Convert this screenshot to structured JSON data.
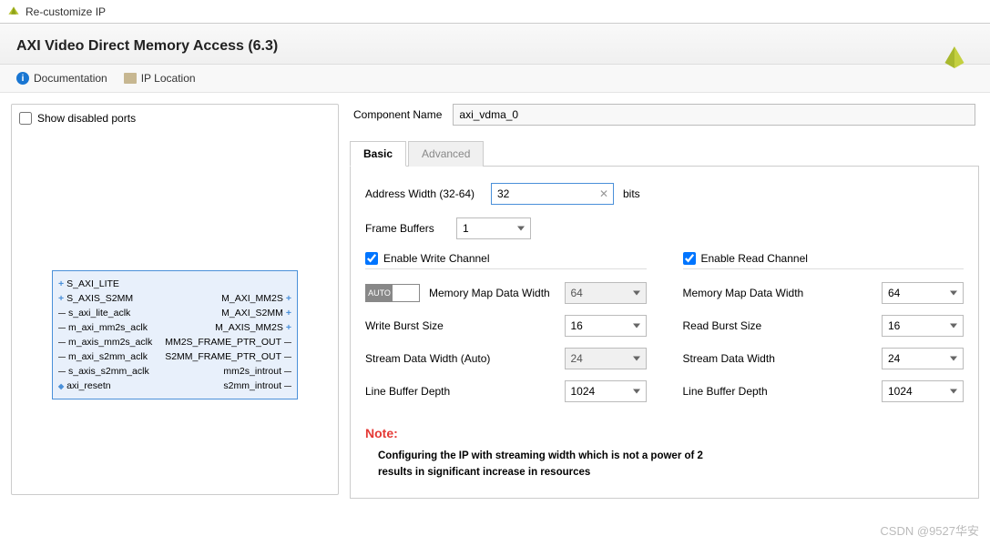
{
  "window": {
    "title": "Re-customize IP"
  },
  "header": {
    "ip_title": "AXI Video Direct Memory Access (6.3)"
  },
  "toolbar": {
    "documentation": "Documentation",
    "ip_location": "IP Location"
  },
  "left": {
    "show_disabled_ports": "Show disabled ports",
    "ports": {
      "left": [
        "S_AXI_LITE",
        "S_AXIS_S2MM",
        "s_axi_lite_aclk",
        "m_axi_mm2s_aclk",
        "m_axis_mm2s_aclk",
        "m_axi_s2mm_aclk",
        "s_axis_s2mm_aclk",
        "axi_resetn"
      ],
      "right": [
        "M_AXI_MM2S",
        "M_AXI_S2MM",
        "M_AXIS_MM2S",
        "MM2S_FRAME_PTR_OUT",
        "S2MM_FRAME_PTR_OUT",
        "mm2s_introut",
        "s2mm_introut"
      ]
    }
  },
  "right": {
    "component_name_label": "Component Name",
    "component_name": "axi_vdma_0",
    "tabs": {
      "basic": "Basic",
      "advanced": "Advanced"
    },
    "basic": {
      "address_width_label": "Address Width (32-64)",
      "address_width_value": "32",
      "address_width_suffix": "bits",
      "frame_buffers_label": "Frame Buffers",
      "frame_buffers_value": "1",
      "write_channel": {
        "enable_label": "Enable Write Channel",
        "auto_label": "AUTO",
        "mem_map_label": "Memory Map Data Width",
        "mem_map_value": "64",
        "burst_label": "Write Burst Size",
        "burst_value": "16",
        "stream_label": "Stream Data Width (Auto)",
        "stream_value": "24",
        "line_buf_label": "Line Buffer Depth",
        "line_buf_value": "1024"
      },
      "read_channel": {
        "enable_label": "Enable Read Channel",
        "mem_map_label": "Memory Map Data Width",
        "mem_map_value": "64",
        "burst_label": "Read Burst Size",
        "burst_value": "16",
        "stream_label": "Stream Data Width",
        "stream_value": "24",
        "line_buf_label": "Line Buffer Depth",
        "line_buf_value": "1024"
      },
      "note_title": "Note:",
      "note_text1": "Configuring the IP with streaming width which is not a power of 2",
      "note_text2": "results in significant increase in resources"
    }
  },
  "watermark": "CSDN @9527华安"
}
